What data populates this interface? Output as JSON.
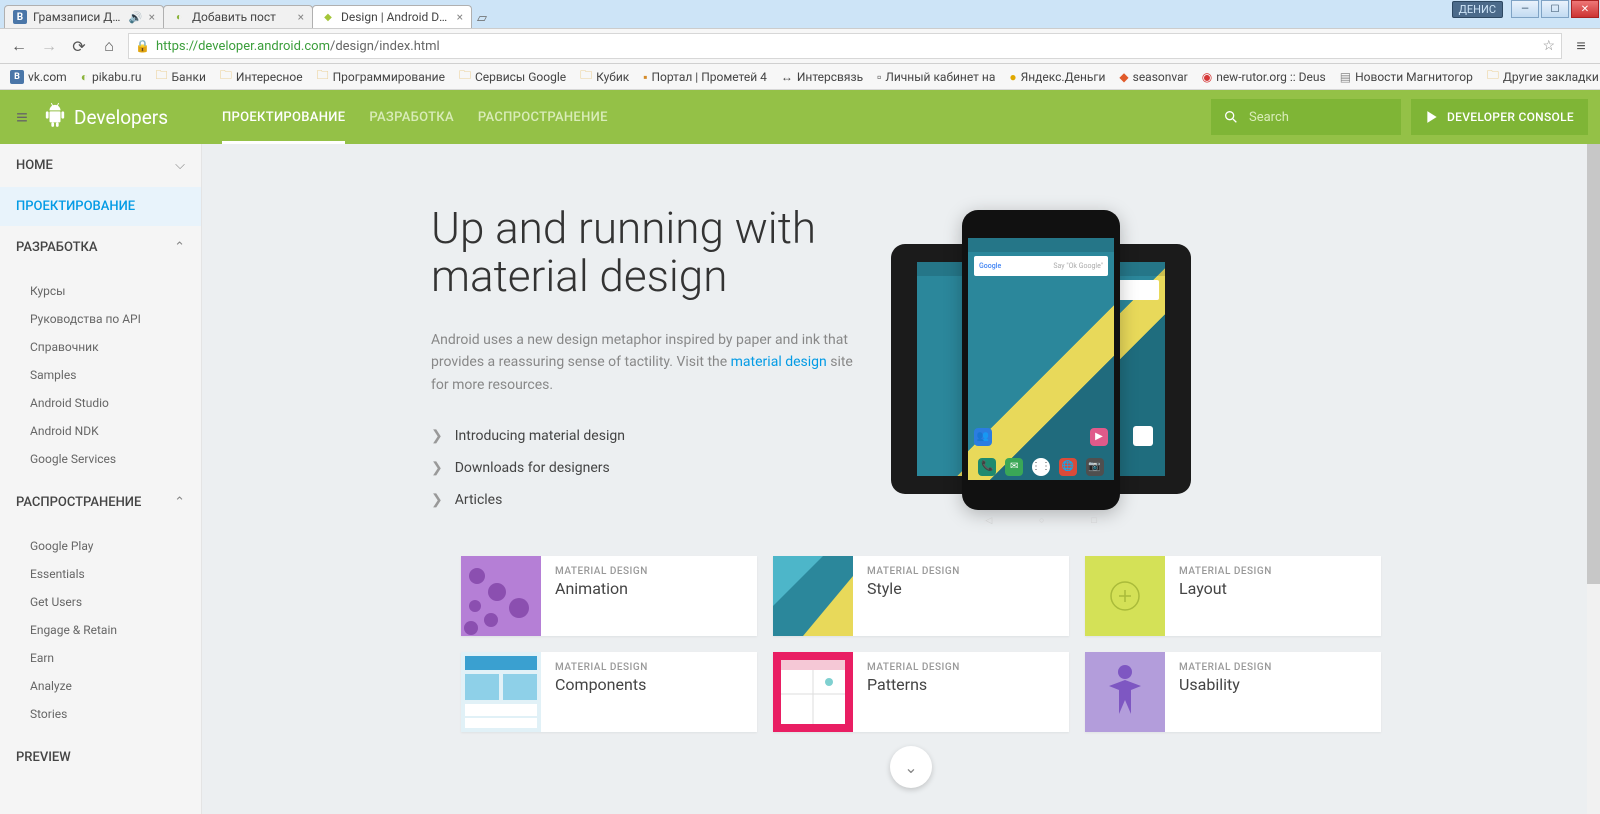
{
  "chrome": {
    "username": "ДЕНИС",
    "tabs": [
      {
        "title": "Грамзаписи Дениса С",
        "favicon": "vk"
      },
      {
        "title": "Добавить пост",
        "favicon": "pikabu"
      },
      {
        "title": "Design | Android Develop",
        "favicon": "android",
        "active": true
      }
    ],
    "url_secure": "https://developer.android.com",
    "url_rest": "/design/index.html",
    "bookmarks": [
      {
        "label": "vk.com",
        "icon": "vk"
      },
      {
        "label": "pikabu.ru",
        "icon": "pikabu"
      },
      {
        "label": "Банки",
        "icon": "folder"
      },
      {
        "label": "Интересное",
        "icon": "folder"
      },
      {
        "label": "Программирование",
        "icon": "folder"
      },
      {
        "label": "Сервисы Google",
        "icon": "folder"
      },
      {
        "label": "Кубик",
        "icon": "folder"
      },
      {
        "label": "Портал | Прометей 4",
        "icon": "page"
      },
      {
        "label": "Интерсвязь",
        "icon": "is"
      },
      {
        "label": "Личный кабинет на",
        "icon": "page"
      },
      {
        "label": "Яндекс.Деньги",
        "icon": "ya"
      },
      {
        "label": "seasonvar",
        "icon": "sv"
      },
      {
        "label": "new-rutor.org :: Deus",
        "icon": "rutor"
      },
      {
        "label": "Новости Магнитогор",
        "icon": "news"
      }
    ],
    "bookmarks_right": "Другие закладки"
  },
  "header": {
    "brand": "Developers",
    "nav": [
      {
        "label": "ПРОЕКТИРОВАНИЕ",
        "active": true
      },
      {
        "label": "РАЗРАБОТКА"
      },
      {
        "label": "РАСПРОСТРАНЕНИЕ"
      }
    ],
    "search_placeholder": "Search",
    "console_label": "DEVELOPER CONSOLE"
  },
  "sidebar": {
    "home": "HOME",
    "active": "ПРОЕКТИРОВАНИЕ",
    "dev_head": "РАЗРАБОТКА",
    "dev_items": [
      "Курсы",
      "Руководства по API",
      "Справочник",
      "Samples",
      "Android Studio",
      "Android NDK",
      "Google Services"
    ],
    "dist_head": "РАСПРОСТРАНЕНИЕ",
    "dist_items": [
      "Google Play",
      "Essentials",
      "Get Users",
      "Engage & Retain",
      "Earn",
      "Analyze",
      "Stories"
    ],
    "preview": "PREVIEW"
  },
  "hero": {
    "title": "Up and running with material design",
    "lead_a": "Android uses a new design metaphor inspired by paper and ink that provides a reassuring sense of tactility. Visit the ",
    "lead_link": "material design",
    "lead_b": " site for more resources.",
    "links": [
      "Introducing material design",
      "Downloads for designers",
      "Articles"
    ],
    "searchpill_brand": "Google",
    "searchpill_hint": "Say \"Ok Google\""
  },
  "cards": [
    {
      "eyebrow": "MATERIAL DESIGN",
      "title": "Animation",
      "thumb": "anim"
    },
    {
      "eyebrow": "MATERIAL DESIGN",
      "title": "Style",
      "thumb": "style"
    },
    {
      "eyebrow": "MATERIAL DESIGN",
      "title": "Layout",
      "thumb": "layout"
    },
    {
      "eyebrow": "MATERIAL DESIGN",
      "title": "Components",
      "thumb": "comp"
    },
    {
      "eyebrow": "MATERIAL DESIGN",
      "title": "Patterns",
      "thumb": "patt"
    },
    {
      "eyebrow": "MATERIAL DESIGN",
      "title": "Usability",
      "thumb": "usab"
    }
  ]
}
